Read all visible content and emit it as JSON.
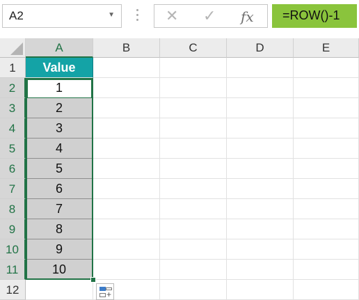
{
  "formula_bar": {
    "name_box": "A2",
    "name_box_dropdown": "▼",
    "cancel_icon": "✕",
    "enter_icon": "✓",
    "fx_label": "fx",
    "formula": "=ROW()-1"
  },
  "colors": {
    "header_fill": "#14A3A6",
    "data_fill": "#D0D0D0",
    "selection": "#217346",
    "formula_highlight": "#8AC43C"
  },
  "grid": {
    "columns": [
      "A",
      "B",
      "C",
      "D",
      "E"
    ],
    "rows": [
      "1",
      "2",
      "3",
      "4",
      "5",
      "6",
      "7",
      "8",
      "9",
      "10",
      "11",
      "12"
    ],
    "header_cell": "Value",
    "values": [
      "1",
      "2",
      "3",
      "4",
      "5",
      "6",
      "7",
      "8",
      "9",
      "10"
    ]
  },
  "icons": {
    "select_all": "select-all-triangle-icon",
    "quick_analysis": "quick-analysis-icon"
  }
}
